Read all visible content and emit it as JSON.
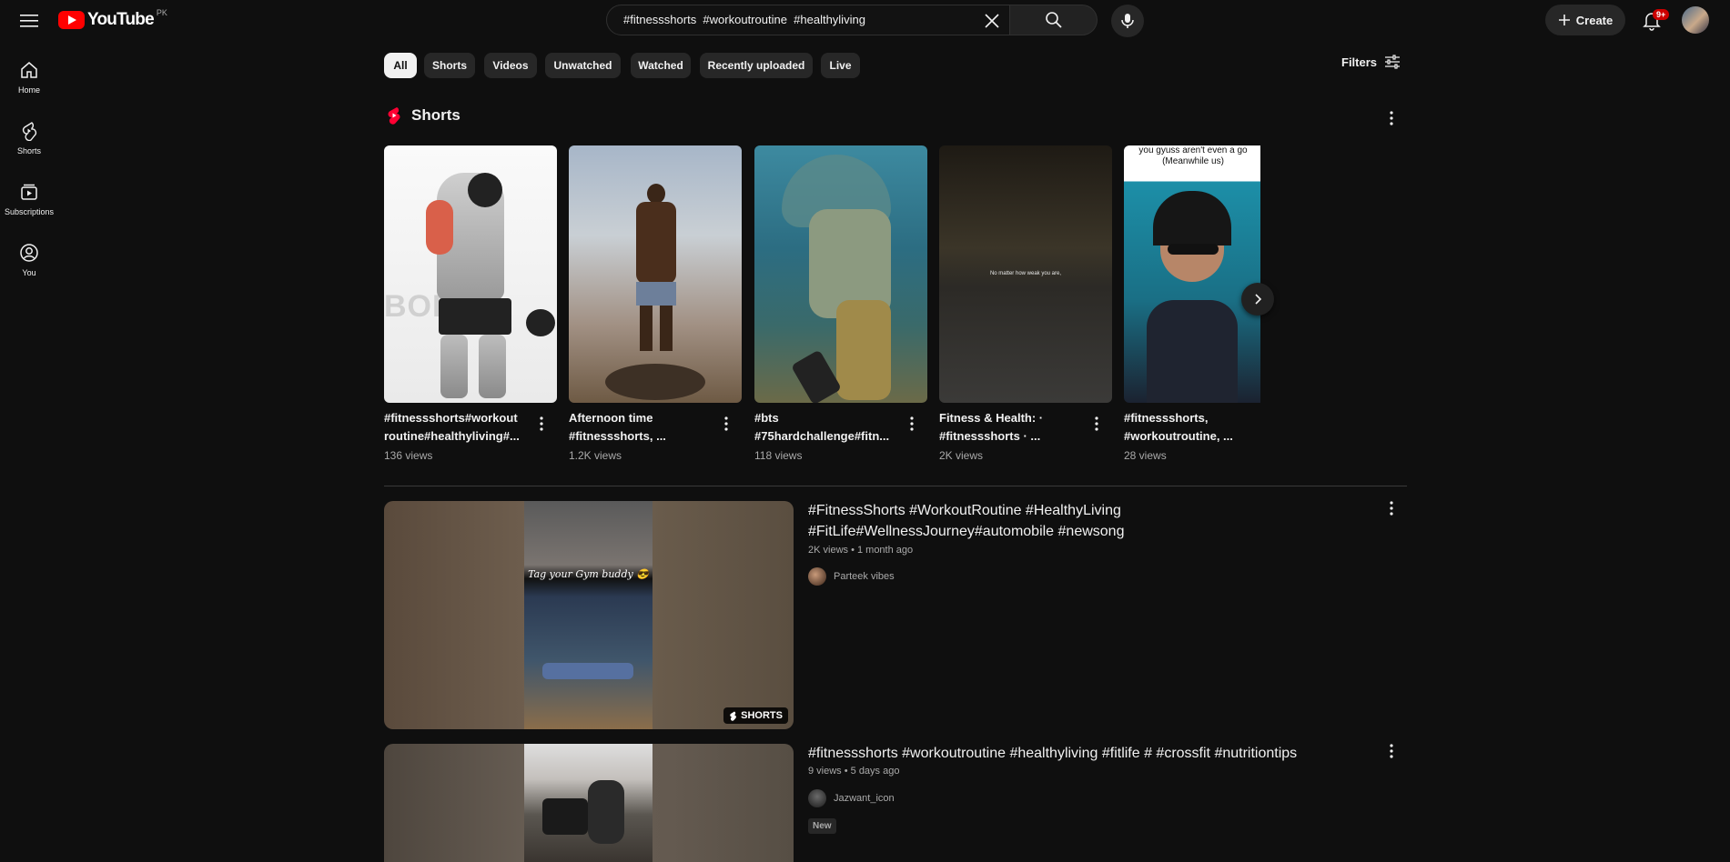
{
  "header": {
    "logo_text": "YouTube",
    "country_code": "PK",
    "search_query": "#fitnessshorts  #workoutroutine  #healthyliving",
    "create_label": "Create",
    "notification_count": "9+"
  },
  "sidebar": {
    "items": [
      {
        "label": "Home",
        "icon": "home-icon"
      },
      {
        "label": "Shorts",
        "icon": "shorts-icon"
      },
      {
        "label": "Subscriptions",
        "icon": "subscriptions-icon"
      },
      {
        "label": "You",
        "icon": "you-icon"
      }
    ]
  },
  "chips": [
    "All",
    "Shorts",
    "Videos",
    "Unwatched",
    "Watched",
    "Recently uploaded",
    "Live"
  ],
  "active_chip": "All",
  "filters_label": "Filters",
  "shorts_section": {
    "title": "Shorts",
    "items": [
      {
        "title": "#fitnessshorts#workout routine#healthyliving#...",
        "views": "136 views",
        "overlay_text": "BODY"
      },
      {
        "title": "Afternoon time  #fitnessshorts, ...",
        "views": "1.2K views"
      },
      {
        "title": "#bts #75hardchallenge#fitn...",
        "views": "118 views"
      },
      {
        "title": "Fitness & Health: · #fitnessshorts · ...",
        "views": "2K views",
        "overlay_text": "No matter how weak you are,"
      },
      {
        "title": "#fitnessshorts, #workoutroutine, ...",
        "views": "28 views",
        "overlay_text": "you gyuss aren't even a go (Meanwhile us)"
      }
    ]
  },
  "videos": [
    {
      "title": "#FitnessShorts #WorkoutRoutine #HealthyLiving #FitLife#WellnessJourney#automobile #newsong",
      "meta": "2K views • 1 month ago",
      "channel": "Parteek vibes",
      "thumb_overlay": "Tag your Gym buddy 😎",
      "badge": "SHORTS"
    },
    {
      "title": "#fitnessshorts #workoutroutine #healthyliving #fitlife # #crossfit #nutritiontips",
      "meta": "9 views • 5 days ago",
      "channel": "Jazwant_icon",
      "new_label": "New"
    }
  ]
}
